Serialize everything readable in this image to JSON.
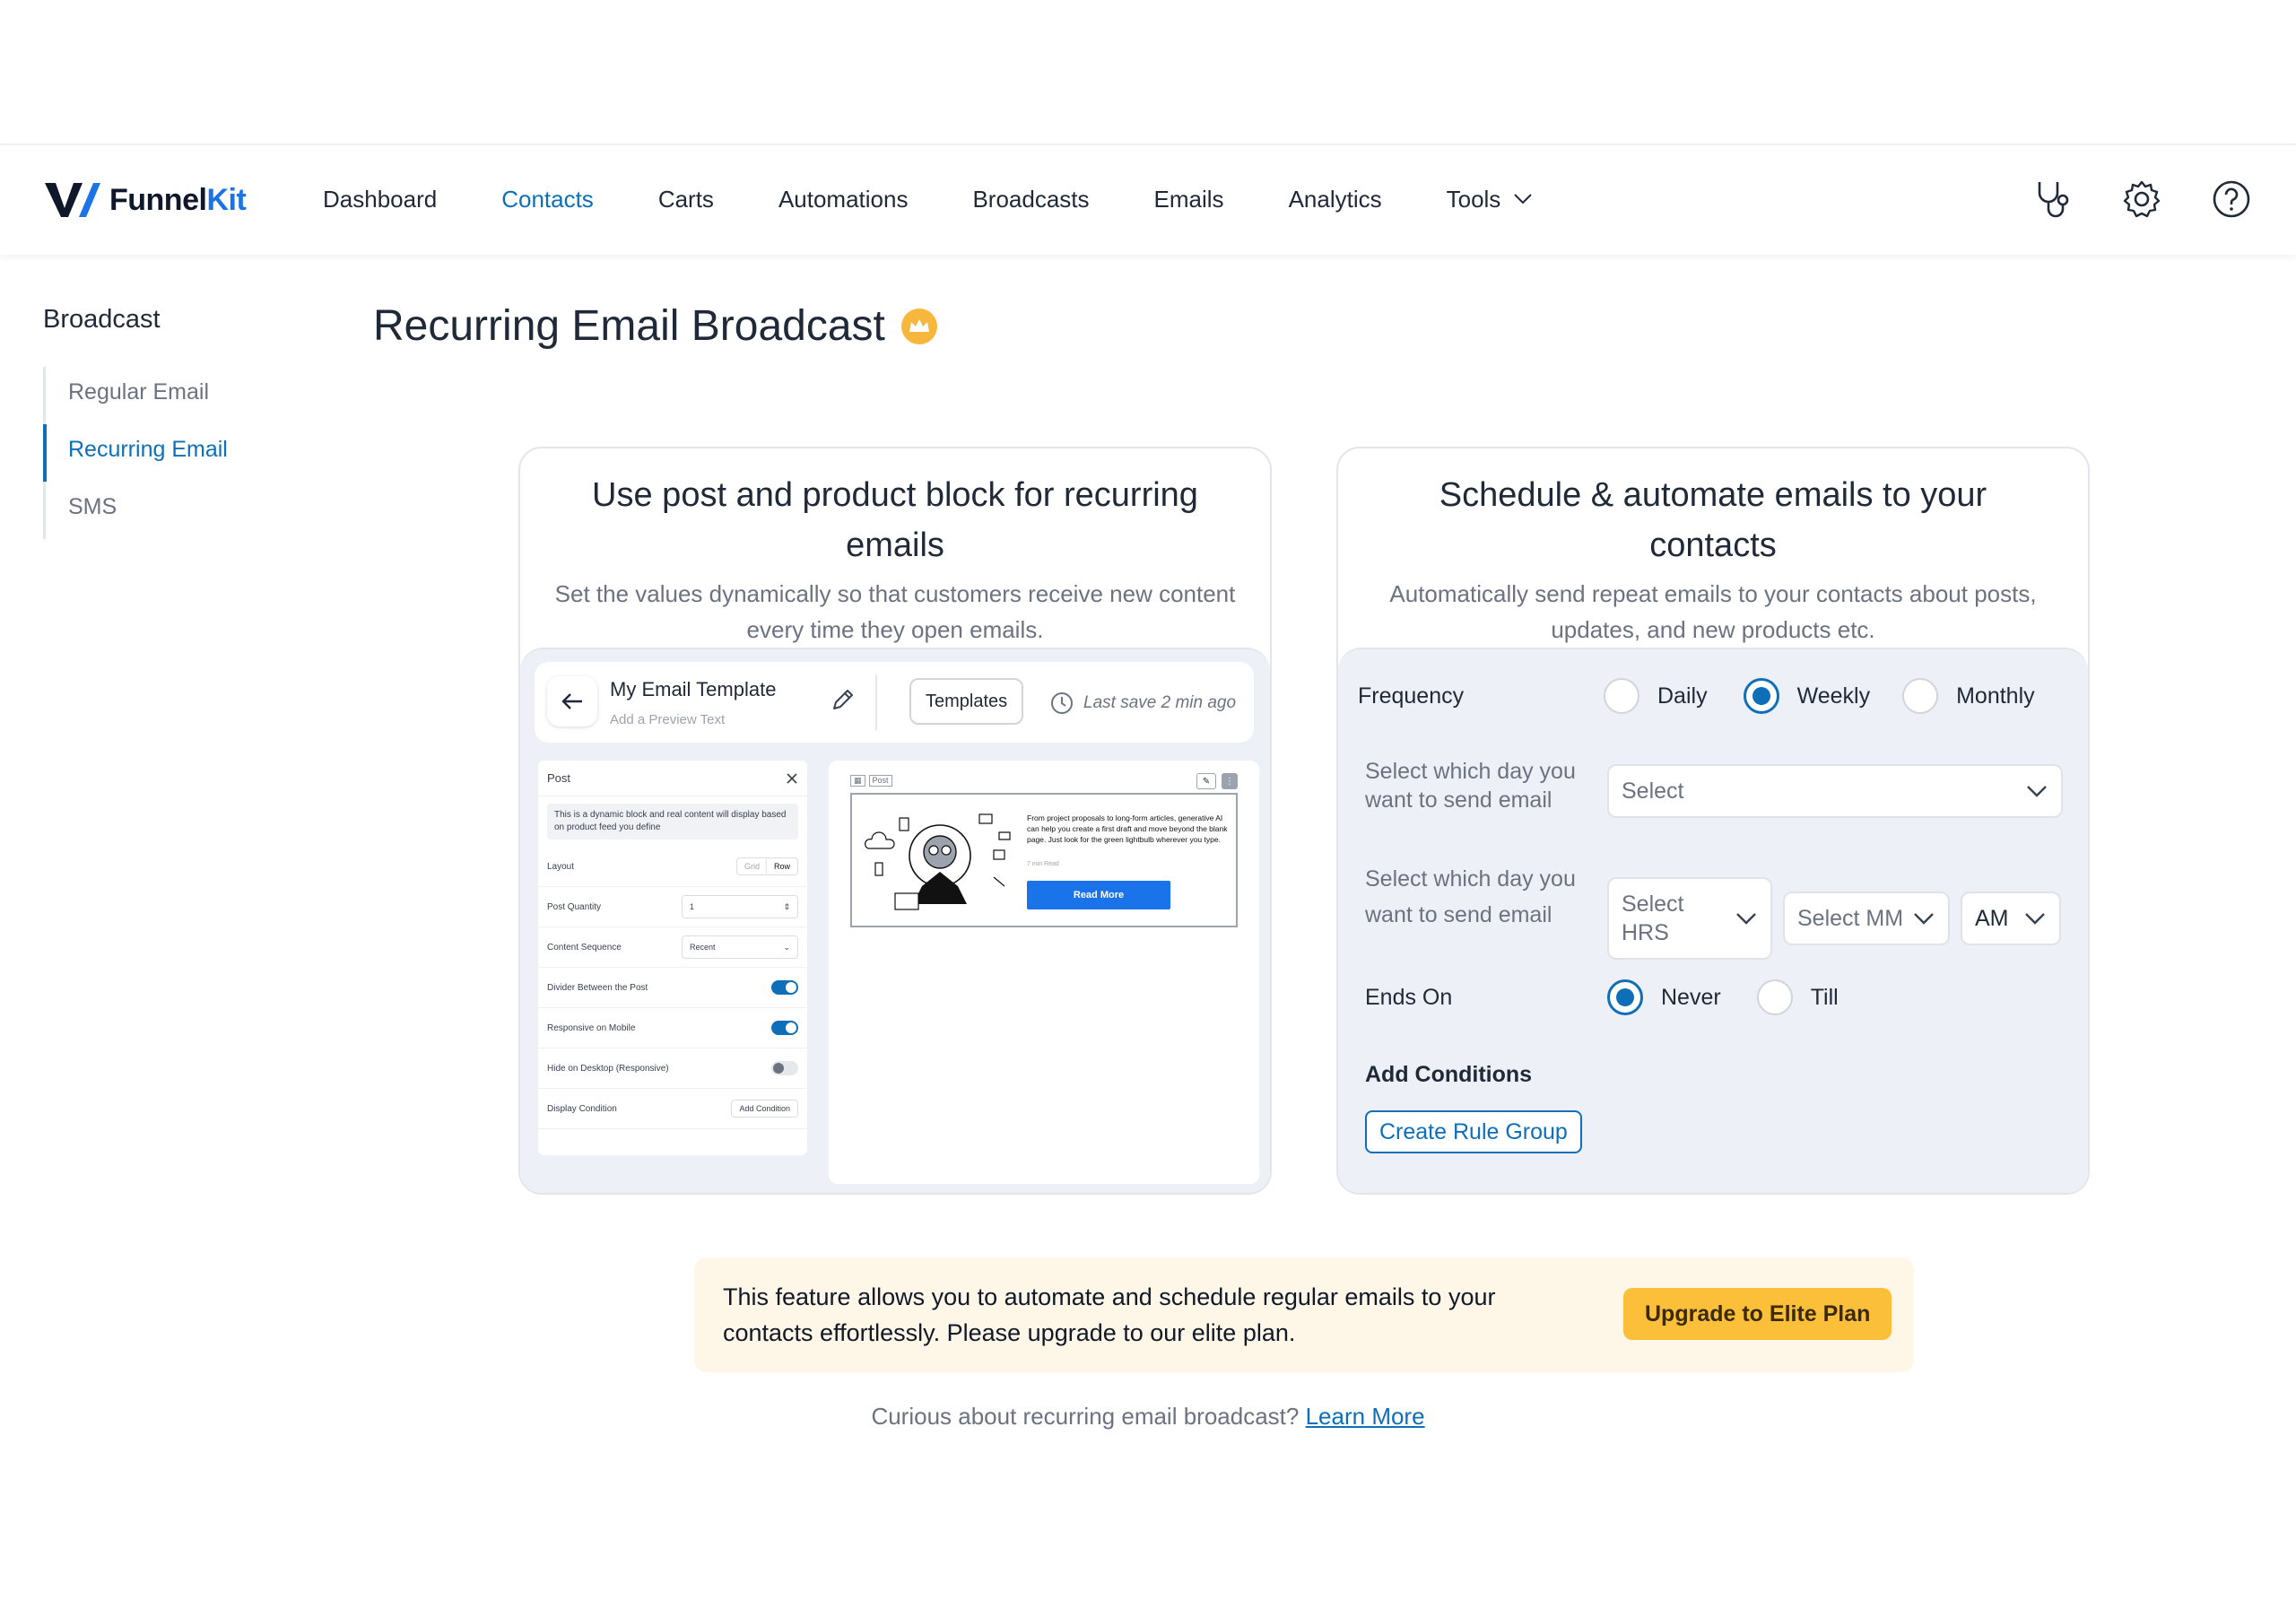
{
  "brand": {
    "name_part1": "Funnel",
    "name_part2": "Kit",
    "accent": "#1a73e8"
  },
  "nav": {
    "items": [
      {
        "label": "Dashboard",
        "active": false
      },
      {
        "label": "Contacts",
        "active": true
      },
      {
        "label": "Carts",
        "active": false
      },
      {
        "label": "Automations",
        "active": false
      },
      {
        "label": "Broadcasts",
        "active": false
      },
      {
        "label": "Emails",
        "active": false
      },
      {
        "label": "Analytics",
        "active": false
      },
      {
        "label": "Tools",
        "active": false
      }
    ],
    "icons": [
      "stethoscope-icon",
      "gear-icon",
      "help-circle-icon"
    ]
  },
  "sidebar": {
    "title": "Broadcast",
    "items": [
      {
        "label": "Regular Email",
        "active": false
      },
      {
        "label": "Recurring Email",
        "active": true
      },
      {
        "label": "SMS",
        "active": false
      }
    ]
  },
  "page": {
    "title": "Recurring Email Broadcast"
  },
  "left_card": {
    "title": "Use post and product block for recurring emails",
    "subtitle": "Set the values dynamically so that customers receive new content every time they open emails.",
    "preview": {
      "template_name": "My Email Template",
      "preview_text": "Add a Preview Text",
      "templates_button": "Templates",
      "last_save": "Last save 2 min ago",
      "panel_title": "Post",
      "panel_note": "This is a dynamic block and real content will display based on product feed you define",
      "layout_label": "Layout",
      "layout_options": [
        "Grid",
        "Row"
      ],
      "quantity_label": "Post Quantity",
      "quantity_value": "1",
      "sequence_label": "Content Sequence",
      "sequence_value": "Recent",
      "divider_label": "Divider Between the Post",
      "responsive_label": "Responsive on Mobile",
      "hide_label": "Hide on Desktop (Responsive)",
      "display_label": "Display Condition",
      "add_condition": "Add Condition",
      "canvas_tag": "Post",
      "post_body": "From project proposals to long-form articles, generative AI can help you create a first draft and move beyond the blank page. Just look for the green lightbulb wherever you type.",
      "post_read": "7 min Read",
      "read_more": "Read More"
    }
  },
  "right_card": {
    "title": "Schedule & automate emails to your contacts",
    "subtitle": "Automatically send repeat emails to your contacts about posts, updates, and new products etc.",
    "frequency_label": "Frequency",
    "frequency_options": [
      {
        "label": "Daily",
        "selected": false
      },
      {
        "label": "Weekly",
        "selected": true
      },
      {
        "label": "Monthly",
        "selected": false
      }
    ],
    "day_label": "Select which day you want to send email",
    "day_select": "Select",
    "time_label": "Select which day you want to send email",
    "hrs_select": "Select HRS",
    "mm_select": "Select MM",
    "ampm_select": "AM",
    "ends_label": "Ends On",
    "ends_options": [
      {
        "label": "Never",
        "selected": true
      },
      {
        "label": "Till",
        "selected": false
      }
    ],
    "conditions_label": "Add Conditions",
    "rule_button": "Create Rule Group"
  },
  "notice": {
    "text": "This feature allows you to automate and schedule regular emails to your contacts effortlessly. Please upgrade to our elite plan.",
    "button": "Upgrade to Elite Plan"
  },
  "footer": {
    "question": "Curious about recurring email broadcast?",
    "link": "Learn More"
  }
}
